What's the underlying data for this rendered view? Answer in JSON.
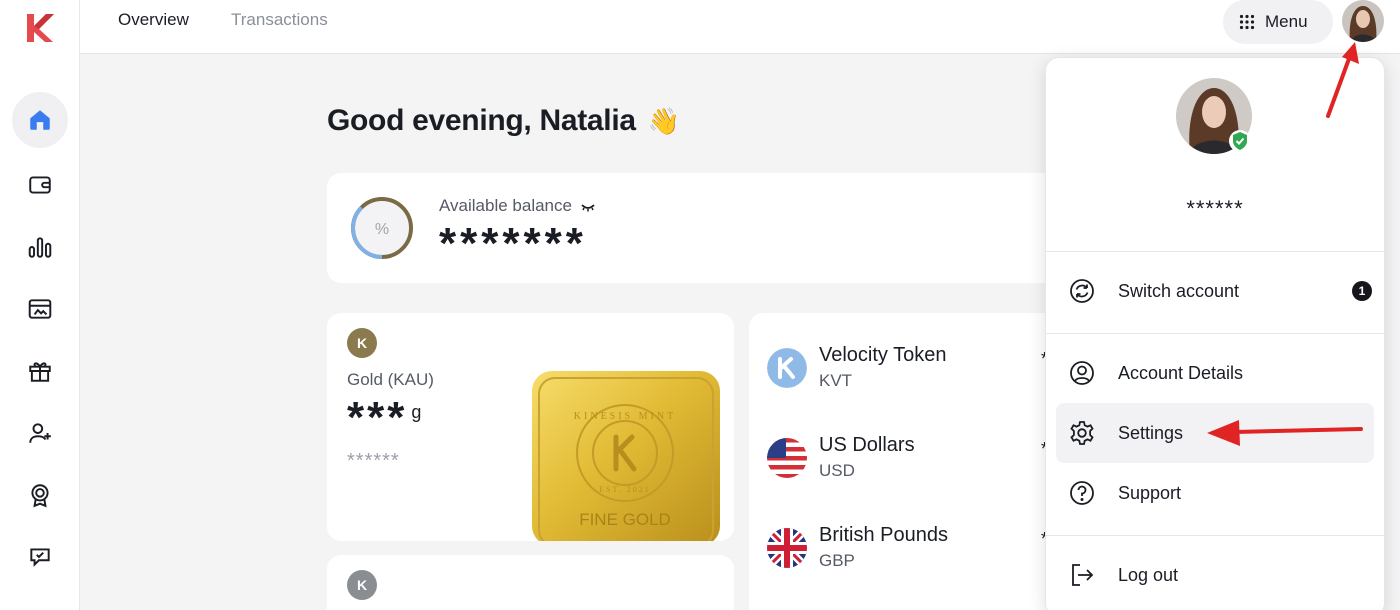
{
  "brand": {
    "accent": "#e5484d",
    "gold": "#8b7a4e"
  },
  "nav": {
    "tabs": [
      {
        "label": "Overview",
        "active": true
      },
      {
        "label": "Transactions",
        "active": false
      }
    ],
    "menu_label": "Menu"
  },
  "sidebar": {
    "items": [
      {
        "icon": "home-icon",
        "active": true
      },
      {
        "icon": "wallet-icon",
        "active": false
      },
      {
        "icon": "chart-icon",
        "active": false
      },
      {
        "icon": "card-icon",
        "active": false
      },
      {
        "icon": "gift-icon",
        "active": false
      },
      {
        "icon": "add-user-icon",
        "active": false
      },
      {
        "icon": "award-icon",
        "active": false
      },
      {
        "icon": "support-chat-icon",
        "active": false
      }
    ]
  },
  "greeting": {
    "text": "Good evening, Natalia",
    "emoji": "👋"
  },
  "balance": {
    "label": "Available balance",
    "value": "*******",
    "ring_symbol": "%"
  },
  "gold": {
    "badge": "K",
    "name": "Gold (KAU)",
    "value": "***",
    "unit": "g",
    "sub_value": "******",
    "bar_text": "FINE GOLD",
    "bar_ring_text": "KINESIS MINT",
    "bar_year": "EST. 2021"
  },
  "second_card": {
    "badge": "K"
  },
  "assets": [
    {
      "name": "Velocity Token",
      "code": "KVT",
      "icon": "kvt-icon",
      "edge": "*"
    },
    {
      "name": "US Dollars",
      "code": "USD",
      "icon": "us-flag-icon",
      "edge": "*"
    },
    {
      "name": "British Pounds",
      "code": "GBP",
      "icon": "uk-flag-icon",
      "edge": "*"
    }
  ],
  "account_menu": {
    "masked_name": "******",
    "items": [
      {
        "label": "Switch account",
        "icon": "switch-account-icon",
        "count": "1"
      },
      {
        "label": "Account Details",
        "icon": "user-circle-icon"
      },
      {
        "label": "Settings",
        "icon": "gear-icon",
        "highlighted": true
      },
      {
        "label": "Support",
        "icon": "help-icon"
      },
      {
        "label": "Log out",
        "icon": "logout-icon"
      }
    ]
  },
  "annotations": {
    "arrow_color": "#e02424"
  }
}
